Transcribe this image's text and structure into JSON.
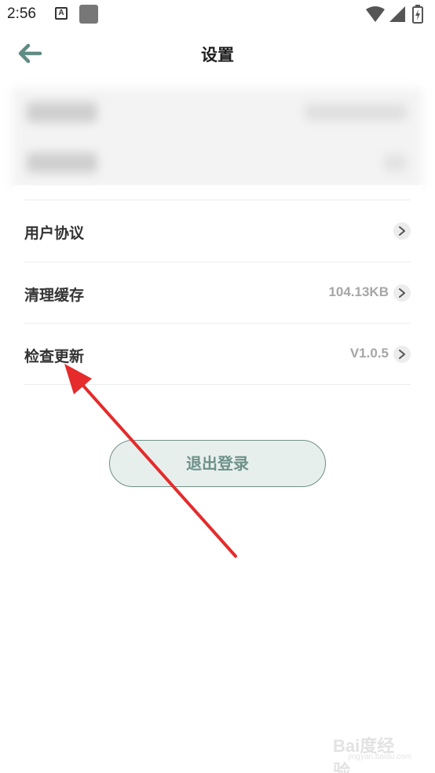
{
  "status_bar": {
    "time": "2:56",
    "icons": [
      "text-a-icon",
      "notification-square-icon",
      "wifi-icon",
      "signal-icon",
      "battery-charging-icon"
    ]
  },
  "header": {
    "title": "设置",
    "back_icon": "back-arrow-icon"
  },
  "settings": [
    {
      "label": "用户协议",
      "value": ""
    },
    {
      "label": "清理缓存",
      "value": "104.13KB"
    },
    {
      "label": "检查更新",
      "value": "V1.0.5"
    }
  ],
  "logout_label": "退出登录",
  "watermark": {
    "brand": "Bai度经验",
    "url": "jingyan.baidu.com"
  },
  "colors": {
    "accent": "#6e9189",
    "logout_bg": "#e7efed",
    "annotation_arrow": "#e52b2b"
  }
}
